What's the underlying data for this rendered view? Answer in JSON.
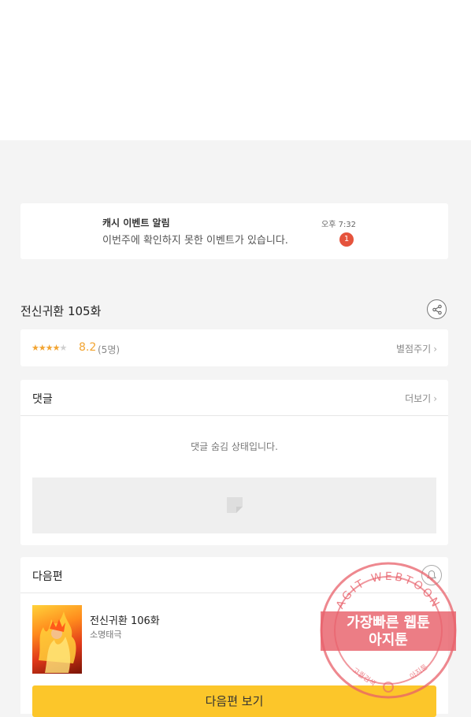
{
  "notification": {
    "title": "캐시 이벤트 알림",
    "message": "이번주에 확인하지 못한 이벤트가 있습니다.",
    "time": "오후 7:32",
    "badge_count": "1"
  },
  "episode": {
    "title": "전신귀환 105화",
    "share_icon": "share-icon"
  },
  "rating": {
    "stars_filled": 4,
    "stars_total": 5,
    "score": "8.2",
    "voters": "(5명)",
    "rate_label": "별점주기"
  },
  "comments": {
    "title": "댓글",
    "more_label": "더보기",
    "hidden_message": "댓글 숨김 상태입니다."
  },
  "next_episode": {
    "section_title": "다음편",
    "title": "전신귀환 106화",
    "author": "소명태극",
    "button_label": "다음편 보기"
  },
  "watermark": {
    "ring_text": "AGIT WEBTOON",
    "line1": "가장빠른 웹툰",
    "line2": "아지툰",
    "bottom_left": "고퀄검색",
    "bottom_right": "아지툰"
  },
  "colors": {
    "accent_yellow": "#fcc62a",
    "star": "#f2a431",
    "badge": "#e5533c",
    "stamp": "#e8606a"
  }
}
